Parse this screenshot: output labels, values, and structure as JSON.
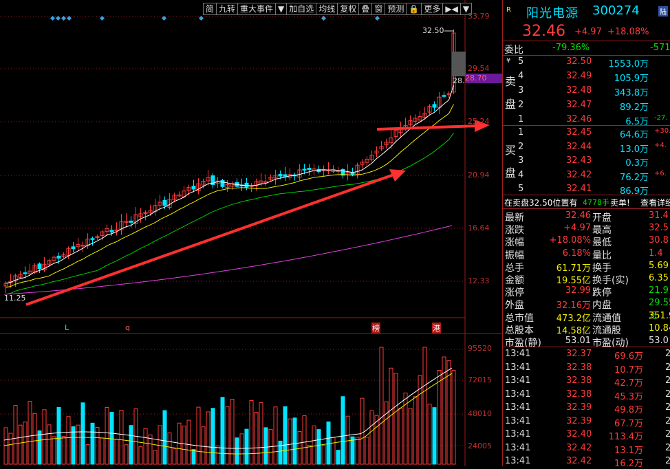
{
  "toolbar": {
    "items": [
      "简",
      "九转",
      "重大事件",
      "▼",
      "加自选",
      "均线",
      "复权",
      "叠",
      "窗",
      "预测",
      "🔒",
      "更多",
      "▶◀",
      "▼"
    ]
  },
  "price_axis": {
    "labels": [
      "33.79",
      "29.54",
      "28.70",
      "25.24",
      "20.94",
      "16.64",
      "12.33"
    ],
    "current_price_label": "32.50",
    "cutoff_label": "28.",
    "low_label": "11.25"
  },
  "volume_axis": {
    "labels": [
      "95520",
      "72015",
      "48010",
      "24005"
    ]
  },
  "markers": {
    "L": "L",
    "q": "q",
    "bang": "榜",
    "gang": "港"
  },
  "stock": {
    "r_badge": "R",
    "name": "阳光电源",
    "code": "300274",
    "badge": "陆",
    "price": "32.46",
    "change": "+4.97",
    "change_pct": "+18.08%"
  },
  "weibi": {
    "label": "委比",
    "value": "-79.36%",
    "diff": "-571"
  },
  "sell": {
    "label1": "卖",
    "label2": "盘",
    "yen": "¥",
    "levels": [
      {
        "level": "5",
        "price": "32.50",
        "vol": "1553.0万",
        "extra": ""
      },
      {
        "level": "4",
        "price": "32.49",
        "vol": "105.9万",
        "extra": ""
      },
      {
        "level": "3",
        "price": "32.48",
        "vol": "343.8万",
        "extra": ""
      },
      {
        "level": "2",
        "price": "32.47",
        "vol": "89.2万",
        "extra": ""
      },
      {
        "level": "1",
        "price": "32.46",
        "vol": "6.5万",
        "extra": "-27."
      }
    ]
  },
  "buy": {
    "label1": "买",
    "label2": "盘",
    "levels": [
      {
        "level": "1",
        "price": "32.45",
        "vol": "64.6万",
        "extra": "+30."
      },
      {
        "level": "2",
        "price": "32.44",
        "vol": "13.0万",
        "extra": "+4."
      },
      {
        "level": "3",
        "price": "32.43",
        "vol": "0.3万",
        "extra": ""
      },
      {
        "level": "4",
        "price": "32.42",
        "vol": "76.2万",
        "extra": "+6."
      },
      {
        "level": "5",
        "price": "32.41",
        "vol": "86.9万",
        "extra": ""
      }
    ]
  },
  "notice": {
    "text": "在卖盘32.50位置有",
    "vol": "4778手",
    "action": "卖单!",
    "link": "查看详细"
  },
  "stats": [
    {
      "l1": "最新",
      "v1": "32.46",
      "c1": "red",
      "l2": "开盘",
      "v2": "31.4",
      "c2": "red"
    },
    {
      "l1": "涨跌",
      "v1": "+4.97",
      "c1": "red",
      "l2": "最高",
      "v2": "32.5",
      "c2": "red"
    },
    {
      "l1": "涨幅",
      "v1": "+18.08%",
      "c1": "red",
      "l2": "最低",
      "v2": "30.8",
      "c2": "red"
    },
    {
      "l1": "振幅",
      "v1": "6.18%",
      "c1": "red",
      "l2": "量比",
      "v2": "1.4",
      "c2": "red"
    },
    {
      "l1": "总手",
      "v1": "61.71万",
      "c1": "yellow",
      "l2": "换手",
      "v2": "5.69",
      "c2": "yellow"
    },
    {
      "l1": "金额",
      "v1": "19.55亿",
      "c1": "yellow",
      "l2": "换手(实)",
      "v2": "6.35",
      "c2": "yellow"
    },
    {
      "l1": "涨停",
      "v1": "32.99",
      "c1": "red",
      "l2": "跌停",
      "v2": "21.9",
      "c2": "green"
    },
    {
      "l1": "外盘",
      "v1": "32.16万",
      "c1": "red",
      "l2": "内盘",
      "v2": "29.55万",
      "c2": "green"
    },
    {
      "l1": "总市值",
      "v1": "473.2亿",
      "c1": "yellow",
      "l2": "流通值",
      "v2": "351.9",
      "c2": "yellow"
    },
    {
      "l1": "总股本",
      "v1": "14.58亿",
      "c1": "yellow",
      "l2": "流通股",
      "v2": "10.84",
      "c2": "yellow"
    },
    {
      "l1": "市盈(静)",
      "v1": "53.01",
      "c1": "white",
      "l2": "市盈(动)",
      "v2": "53.0",
      "c2": "white"
    }
  ],
  "ticks": [
    {
      "time": "13:41",
      "price": "32.37",
      "vol": "69.6万",
      "x": "2"
    },
    {
      "time": "13:41",
      "price": "32.38",
      "vol": "10.7万",
      "x": "2"
    },
    {
      "time": "13:41",
      "price": "32.38",
      "vol": "42.7万",
      "x": "2"
    },
    {
      "time": "13:41",
      "price": "32.38",
      "vol": "45.3万",
      "x": "2"
    },
    {
      "time": "13:41",
      "price": "32.39",
      "vol": "49.8万",
      "x": "2"
    },
    {
      "time": "13:41",
      "price": "32.39",
      "vol": "67.7万",
      "x": "2"
    },
    {
      "time": "13:41",
      "price": "32.40",
      "vol": "113.4万",
      "x": "2"
    },
    {
      "time": "13:41",
      "price": "32.42",
      "vol": "13.1万",
      "x": "2"
    },
    {
      "time": "13:41",
      "price": "32.42",
      "vol": "16.2万",
      "x": "2"
    }
  ],
  "colors": {
    "up": "#ff3c3c",
    "down": "#00e5ff",
    "ma5": "#ffffff",
    "ma10": "#f0f000",
    "ma20": "#00d000",
    "ma60": "#e040e0",
    "arrow": "#ff3030",
    "grid": "#a01818",
    "highlight": "#6a1a9a"
  }
}
